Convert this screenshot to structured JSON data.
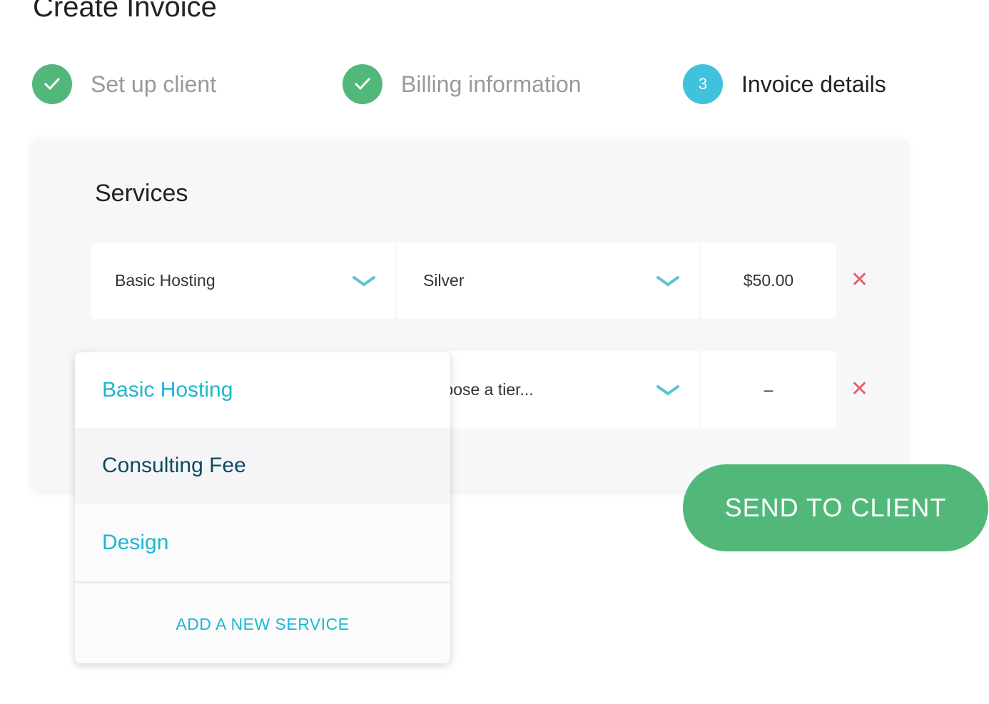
{
  "title": "Create Invoice",
  "steps": [
    {
      "label": "Set up client",
      "state": "done"
    },
    {
      "label": "Billing information",
      "state": "done"
    },
    {
      "label": "Invoice details",
      "number": "3",
      "state": "active"
    }
  ],
  "colors": {
    "green": "#52b87a",
    "accent": "#1bb8d0",
    "active_step": "#3fc3dd",
    "remove": "#e2606c"
  },
  "services": {
    "heading": "Services",
    "rows": [
      {
        "service": "Basic Hosting",
        "tier": "Silver",
        "price": "$50.00"
      },
      {
        "service": "",
        "tier": "Choose a tier...",
        "price": "–"
      }
    ]
  },
  "dropdown": {
    "options": [
      "Basic Hosting",
      "Consulting Fee",
      "Design"
    ],
    "add_label": "ADD A NEW SERVICE"
  },
  "send_label": "SEND TO CLIENT"
}
